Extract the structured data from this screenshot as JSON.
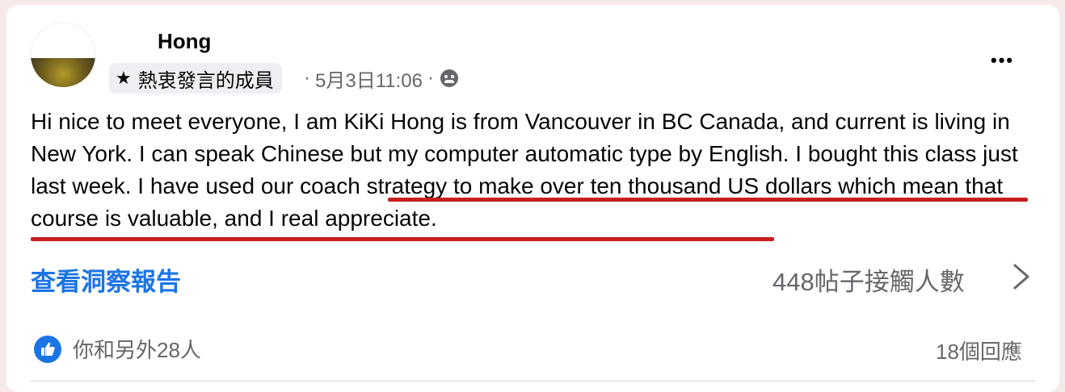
{
  "post": {
    "author_name": "Hong",
    "badge_label": "熱衷發言的成員",
    "timestamp": "5月3日11:06",
    "meta_separator": "·",
    "audience_icon": "group-icon",
    "more_icon": "more-options-icon",
    "more_label": "•••",
    "body": "Hi nice to meet everyone, I am KiKi Hong is from Vancouver in BC Canada, and current is living in New York.  I can speak Chinese but my computer automatic type by English. I bought this class just last week. I have used our coach strategy to make over ten thousand US dollars which mean that course is valuable, and I real appreciate.",
    "highlight_color": "#c81e1e"
  },
  "insights": {
    "link_label": "查看洞察報告",
    "reach_label": "448帖子接觸人數"
  },
  "footer": {
    "reactions_label": "你和另外28人",
    "comments_label": "18個回應"
  },
  "colors": {
    "accent": "#1b74e4",
    "secondary_text": "#65676b",
    "primary_text": "#050505"
  }
}
